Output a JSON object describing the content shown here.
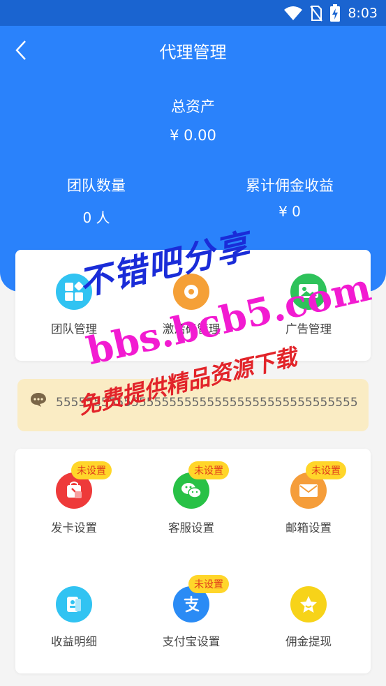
{
  "status_bar": {
    "time": "8:03"
  },
  "header": {
    "title": "代理管理"
  },
  "summary": {
    "total_label": "总资产",
    "total_value": "¥ 0.00",
    "team_label": "团队数量",
    "team_value": "0 人",
    "commission_label": "累计佣金收益",
    "commission_value": "¥ 0"
  },
  "top_menu": [
    {
      "label": "团队管理",
      "icon": "team-icon",
      "color": "#31c3f2"
    },
    {
      "label": "激活码管理",
      "icon": "activation-code-icon",
      "color": "#f5a037"
    },
    {
      "label": "广告管理",
      "icon": "ad-image-icon",
      "color": "#2ec25a"
    }
  ],
  "notice": {
    "icon": "message-icon",
    "text": "5555555555555555555555555555555555555555"
  },
  "settings": [
    {
      "label": "发卡设置",
      "badge": "未设置",
      "icon": "card-bag-icon",
      "color": "#ee3a3a"
    },
    {
      "label": "客服设置",
      "badge": "未设置",
      "icon": "wechat-icon",
      "color": "#28c146"
    },
    {
      "label": "邮箱设置",
      "badge": "未设置",
      "icon": "mail-icon",
      "color": "#f59d3a"
    },
    {
      "label": "收益明细",
      "badge": "",
      "icon": "earnings-cards-icon",
      "color": "#31c3f2"
    },
    {
      "label": "支付宝设置",
      "badge": "未设置",
      "icon": "alipay-icon",
      "color": "#2a8bf5"
    },
    {
      "label": "佣金提现",
      "badge": "",
      "icon": "star-icon",
      "color": "#f7d319"
    }
  ],
  "watermark": {
    "line1": "不错吧分享",
    "line2": "bbs.bcb5.com",
    "line3": "免费提供精品资源下载"
  }
}
